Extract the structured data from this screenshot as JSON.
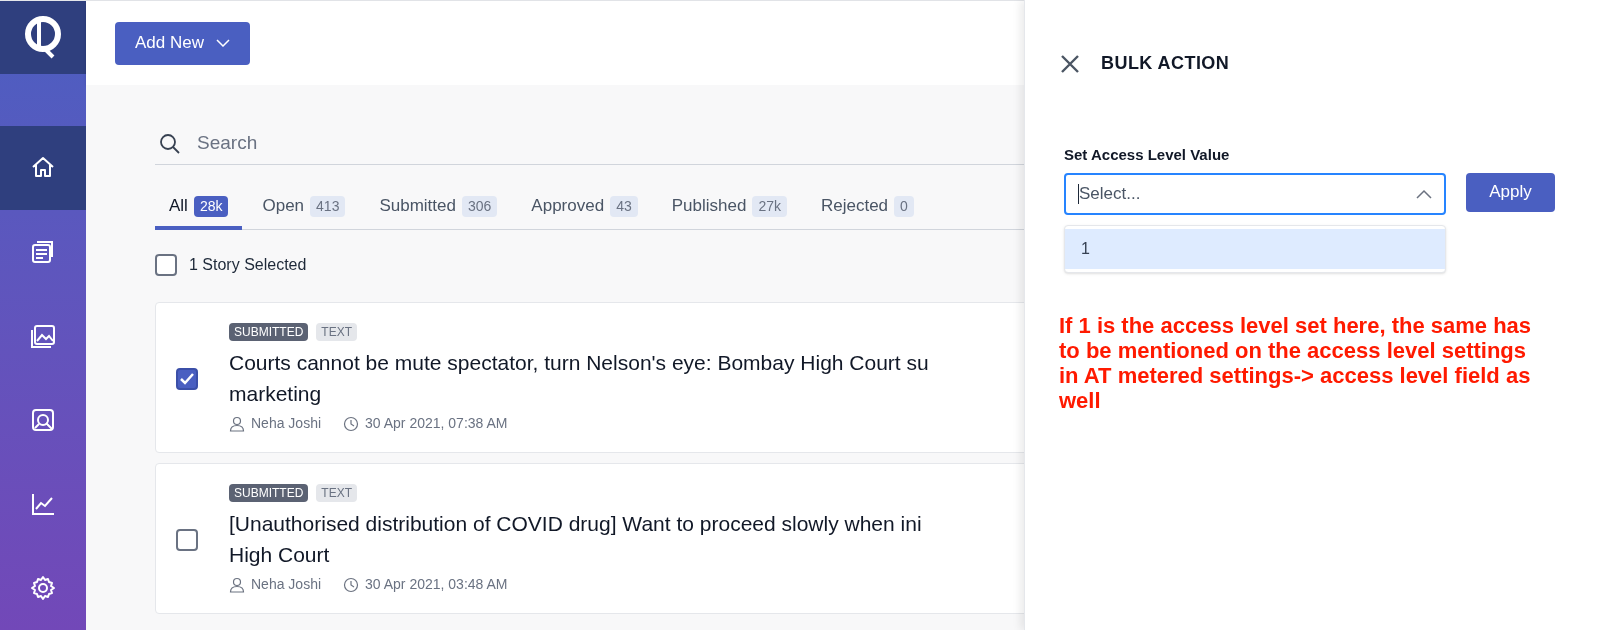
{
  "sidebar": {
    "items": [
      {
        "kind": "home",
        "selected": true
      },
      {
        "kind": "stories",
        "selected": false
      },
      {
        "kind": "media",
        "selected": false
      },
      {
        "kind": "tools",
        "selected": false
      },
      {
        "kind": "analytics",
        "selected": false
      },
      {
        "kind": "settings",
        "selected": false
      }
    ]
  },
  "add_button": {
    "label": "Add New"
  },
  "search": {
    "placeholder": "Search"
  },
  "tabs": [
    {
      "label": "All",
      "count": "28k",
      "selected": true
    },
    {
      "label": "Open",
      "count": "413",
      "selected": false
    },
    {
      "label": "Submitted",
      "count": "306",
      "selected": false
    },
    {
      "label": "Approved",
      "count": "43",
      "selected": false
    },
    {
      "label": "Published",
      "count": "27k",
      "selected": false
    },
    {
      "label": "Rejected",
      "count": "0",
      "selected": false
    }
  ],
  "select_all": {
    "label": "1 Story Selected",
    "checked": false
  },
  "stories": [
    {
      "status": "SUBMITTED",
      "type": "TEXT",
      "title_lines": [
        "Courts cannot be mute spectator, turn Nelson's eye: Bombay High Court su",
        "marketing"
      ],
      "author": "Neha Joshi",
      "time": "30 Apr 2021, 07:38 AM",
      "checked": true
    },
    {
      "status": "SUBMITTED",
      "type": "TEXT",
      "title_lines": [
        "[Unauthorised distribution of COVID drug] Want to proceed slowly when ini",
        "High Court"
      ],
      "author": "Neha Joshi",
      "time": "30 Apr 2021, 03:48 AM",
      "checked": false
    }
  ],
  "panel": {
    "title": "BULK ACTION",
    "field_label": "Set Access Level Value",
    "select": {
      "placeholder": "Select...",
      "expanded": true
    },
    "options": [
      {
        "label": "1",
        "selected": true
      }
    ],
    "apply": "Apply",
    "note": "If 1 is the access level set here, the same has to be mentioned on the access level settings in AT metered settings-> access level field as well"
  }
}
